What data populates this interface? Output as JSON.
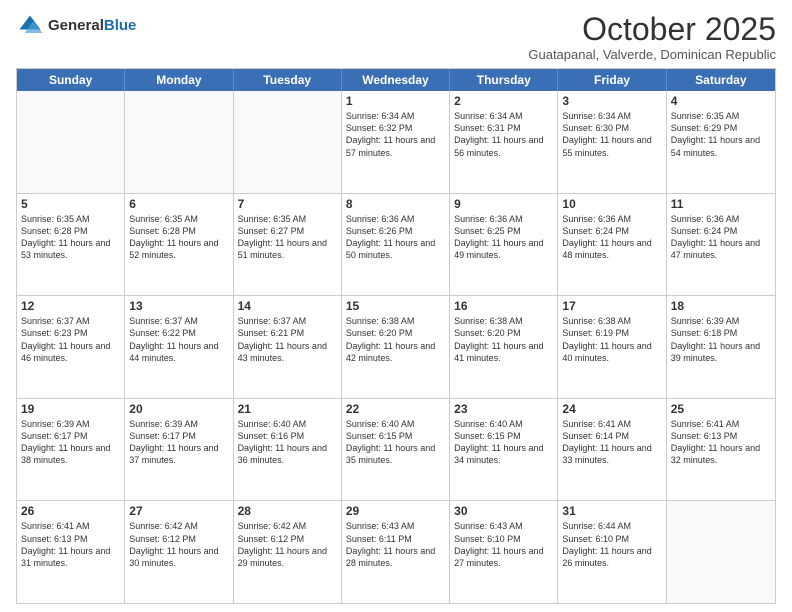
{
  "header": {
    "logo": {
      "general": "General",
      "blue": "Blue"
    },
    "title": "October 2025",
    "subtitle": "Guatapanal, Valverde, Dominican Republic"
  },
  "days_of_week": [
    "Sunday",
    "Monday",
    "Tuesday",
    "Wednesday",
    "Thursday",
    "Friday",
    "Saturday"
  ],
  "weeks": [
    [
      {
        "day": "",
        "empty": true
      },
      {
        "day": "",
        "empty": true
      },
      {
        "day": "",
        "empty": true
      },
      {
        "day": "1",
        "sunrise": "6:34 AM",
        "sunset": "6:32 PM",
        "daylight": "11 hours and 57 minutes."
      },
      {
        "day": "2",
        "sunrise": "6:34 AM",
        "sunset": "6:31 PM",
        "daylight": "11 hours and 56 minutes."
      },
      {
        "day": "3",
        "sunrise": "6:34 AM",
        "sunset": "6:30 PM",
        "daylight": "11 hours and 55 minutes."
      },
      {
        "day": "4",
        "sunrise": "6:35 AM",
        "sunset": "6:29 PM",
        "daylight": "11 hours and 54 minutes."
      }
    ],
    [
      {
        "day": "5",
        "sunrise": "6:35 AM",
        "sunset": "6:28 PM",
        "daylight": "11 hours and 53 minutes."
      },
      {
        "day": "6",
        "sunrise": "6:35 AM",
        "sunset": "6:28 PM",
        "daylight": "11 hours and 52 minutes."
      },
      {
        "day": "7",
        "sunrise": "6:35 AM",
        "sunset": "6:27 PM",
        "daylight": "11 hours and 51 minutes."
      },
      {
        "day": "8",
        "sunrise": "6:36 AM",
        "sunset": "6:26 PM",
        "daylight": "11 hours and 50 minutes."
      },
      {
        "day": "9",
        "sunrise": "6:36 AM",
        "sunset": "6:25 PM",
        "daylight": "11 hours and 49 minutes."
      },
      {
        "day": "10",
        "sunrise": "6:36 AM",
        "sunset": "6:24 PM",
        "daylight": "11 hours and 48 minutes."
      },
      {
        "day": "11",
        "sunrise": "6:36 AM",
        "sunset": "6:24 PM",
        "daylight": "11 hours and 47 minutes."
      }
    ],
    [
      {
        "day": "12",
        "sunrise": "6:37 AM",
        "sunset": "6:23 PM",
        "daylight": "11 hours and 46 minutes."
      },
      {
        "day": "13",
        "sunrise": "6:37 AM",
        "sunset": "6:22 PM",
        "daylight": "11 hours and 44 minutes."
      },
      {
        "day": "14",
        "sunrise": "6:37 AM",
        "sunset": "6:21 PM",
        "daylight": "11 hours and 43 minutes."
      },
      {
        "day": "15",
        "sunrise": "6:38 AM",
        "sunset": "6:20 PM",
        "daylight": "11 hours and 42 minutes."
      },
      {
        "day": "16",
        "sunrise": "6:38 AM",
        "sunset": "6:20 PM",
        "daylight": "11 hours and 41 minutes."
      },
      {
        "day": "17",
        "sunrise": "6:38 AM",
        "sunset": "6:19 PM",
        "daylight": "11 hours and 40 minutes."
      },
      {
        "day": "18",
        "sunrise": "6:39 AM",
        "sunset": "6:18 PM",
        "daylight": "11 hours and 39 minutes."
      }
    ],
    [
      {
        "day": "19",
        "sunrise": "6:39 AM",
        "sunset": "6:17 PM",
        "daylight": "11 hours and 38 minutes."
      },
      {
        "day": "20",
        "sunrise": "6:39 AM",
        "sunset": "6:17 PM",
        "daylight": "11 hours and 37 minutes."
      },
      {
        "day": "21",
        "sunrise": "6:40 AM",
        "sunset": "6:16 PM",
        "daylight": "11 hours and 36 minutes."
      },
      {
        "day": "22",
        "sunrise": "6:40 AM",
        "sunset": "6:15 PM",
        "daylight": "11 hours and 35 minutes."
      },
      {
        "day": "23",
        "sunrise": "6:40 AM",
        "sunset": "6:15 PM",
        "daylight": "11 hours and 34 minutes."
      },
      {
        "day": "24",
        "sunrise": "6:41 AM",
        "sunset": "6:14 PM",
        "daylight": "11 hours and 33 minutes."
      },
      {
        "day": "25",
        "sunrise": "6:41 AM",
        "sunset": "6:13 PM",
        "daylight": "11 hours and 32 minutes."
      }
    ],
    [
      {
        "day": "26",
        "sunrise": "6:41 AM",
        "sunset": "6:13 PM",
        "daylight": "11 hours and 31 minutes."
      },
      {
        "day": "27",
        "sunrise": "6:42 AM",
        "sunset": "6:12 PM",
        "daylight": "11 hours and 30 minutes."
      },
      {
        "day": "28",
        "sunrise": "6:42 AM",
        "sunset": "6:12 PM",
        "daylight": "11 hours and 29 minutes."
      },
      {
        "day": "29",
        "sunrise": "6:43 AM",
        "sunset": "6:11 PM",
        "daylight": "11 hours and 28 minutes."
      },
      {
        "day": "30",
        "sunrise": "6:43 AM",
        "sunset": "6:10 PM",
        "daylight": "11 hours and 27 minutes."
      },
      {
        "day": "31",
        "sunrise": "6:44 AM",
        "sunset": "6:10 PM",
        "daylight": "11 hours and 26 minutes."
      },
      {
        "day": "",
        "empty": true
      }
    ]
  ],
  "labels": {
    "sunrise": "Sunrise:",
    "sunset": "Sunset:",
    "daylight": "Daylight:"
  }
}
